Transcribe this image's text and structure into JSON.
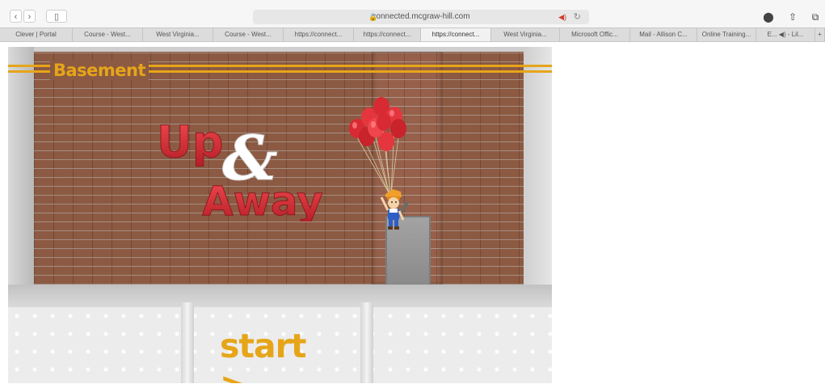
{
  "browser": {
    "nav": {
      "back": "‹",
      "forward": "›",
      "sidebar": "▯"
    },
    "address": {
      "lock": "🔒",
      "url": "connected.mcgraw-hill.com",
      "sound": "◀)",
      "reload": "↻"
    },
    "toolbar_right": {
      "shield": "⬤",
      "share": "⇧",
      "tabs": "⧉"
    },
    "tabs": [
      {
        "label": "Clever | Portal"
      },
      {
        "label": "Course - West..."
      },
      {
        "label": "West Virginia..."
      },
      {
        "label": "Course - West..."
      },
      {
        "label": "https://connect..."
      },
      {
        "label": "https://connect..."
      },
      {
        "label": "https://connect...",
        "active": true
      },
      {
        "label": "West Virginia..."
      },
      {
        "label": "Microsoft Offic..."
      },
      {
        "label": "Mail - Allison C..."
      },
      {
        "label": "Online Training..."
      },
      {
        "label": "E... ◀) - Lil..."
      },
      {
        "label": "+"
      }
    ]
  },
  "game": {
    "floor_label": "Basement",
    "logo": {
      "line1": "Up",
      "amp": "&",
      "line2": "Away"
    },
    "start_label": "start >",
    "colors": {
      "accent": "#e6a519",
      "logo_red": "#d52b34",
      "brick": "#8c5a42"
    }
  }
}
